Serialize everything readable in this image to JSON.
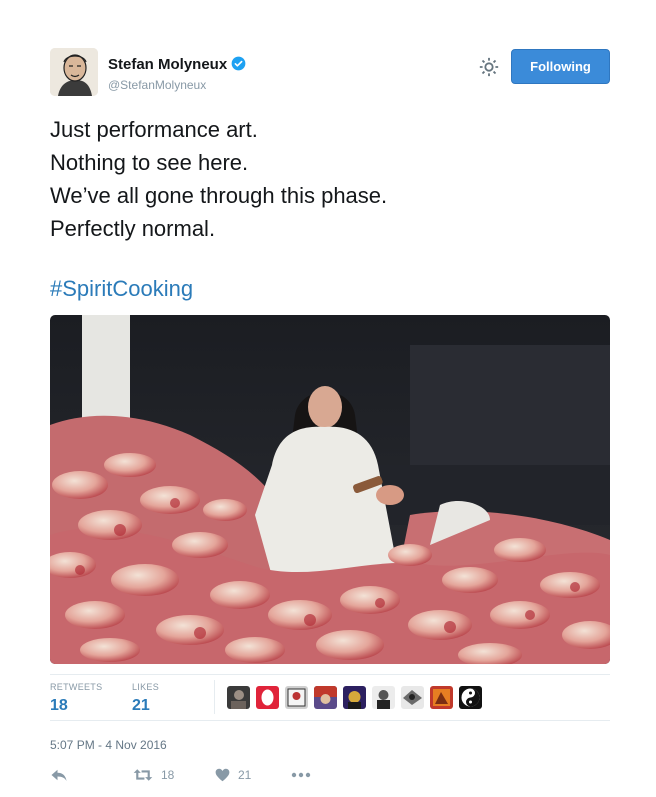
{
  "user": {
    "display_name": "Stefan Molyneux",
    "handle": "@StefanMolyneux",
    "verified_icon": "verified-badge-icon"
  },
  "follow_button": {
    "label": "Following"
  },
  "tweet": {
    "lines": [
      "Just performance art.",
      "Nothing to see here.",
      "We’ve all gone through this phase.",
      "Perfectly normal."
    ],
    "hashtag": "#SpiritCooking"
  },
  "stats": {
    "retweets_label": "RETWEETS",
    "retweets_count": "18",
    "likes_label": "LIKES",
    "likes_count": "21"
  },
  "timestamp": "5:07 PM - 4 Nov 2016",
  "actions": {
    "reply_icon": "reply-icon",
    "retweet_icon": "retweet-icon",
    "retweet_count": "18",
    "like_icon": "heart-icon",
    "like_count": "21",
    "more_icon": "more-dots-icon"
  },
  "colors": {
    "link": "#2b7bb9",
    "follow_button": "#3b8bd9",
    "muted": "#8899a6"
  }
}
